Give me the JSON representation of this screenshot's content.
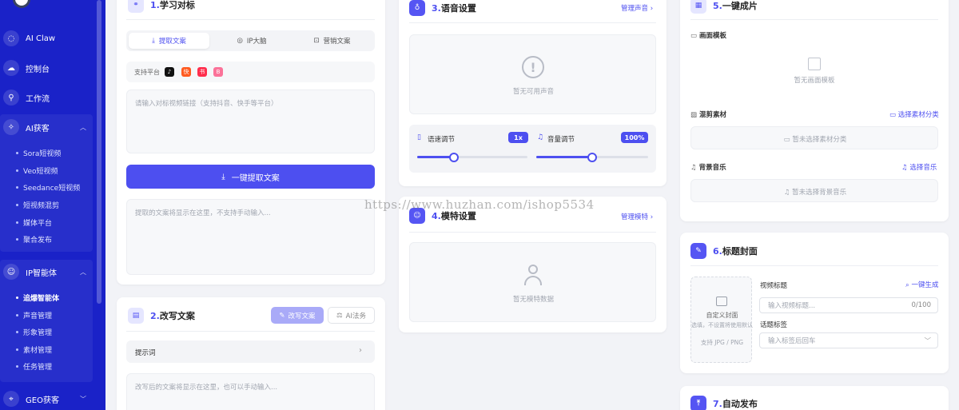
{
  "sidebar": {
    "items": [
      {
        "label": "AI Claw",
        "icon": "chat-icon"
      },
      {
        "label": "控制台",
        "icon": "cloud-icon"
      },
      {
        "label": "工作流",
        "icon": "flow-icon"
      },
      {
        "label": "AI获客",
        "icon": "sparkle-icon"
      }
    ],
    "ai_sub": [
      "Sora短视频",
      "Veo短视频",
      "Seedance短视频",
      "短视频混剪",
      "媒体平台",
      "聚合发布"
    ],
    "ip_group": {
      "label": "IP智能体",
      "icon": "user-icon"
    },
    "ip_sub": [
      "追爆智能体",
      "声音管理",
      "形象管理",
      "素材管理",
      "任务管理"
    ],
    "geo": {
      "label": "GEO获客",
      "icon": "location-icon"
    }
  },
  "learn": {
    "num": "1.",
    "title": "学习对标",
    "tabs": [
      "提取文案",
      "IP大脑",
      "营销文案"
    ],
    "platform_label": "支持平台",
    "platforms": [
      {
        "name": "douyin",
        "glyph": "♪",
        "color": "#111111"
      },
      {
        "name": "kuaishou",
        "glyph": "快",
        "color": "#ff5a1f"
      },
      {
        "name": "xiaohongshu",
        "glyph": "书",
        "color": "#ff2e4d"
      },
      {
        "name": "bilibili",
        "glyph": "B",
        "color": "#fb7299"
      }
    ],
    "link_placeholder": "请输入对标视频链接（支持抖音、快手等平台）",
    "extract_button": "一键提取文案",
    "result_placeholder": "提取的文案将显示在这里，不支持手动输入..."
  },
  "rewrite": {
    "num": "2.",
    "title": "改写文案",
    "rewrite_button": "改写文案",
    "ai_button": "AI法务",
    "prompt_label": "提示词",
    "result_placeholder": "改写后的文案将显示在这里，也可以手动输入..."
  },
  "voice": {
    "num": "3.",
    "title": "语音设置",
    "manage_link": "管理声音",
    "empty_text": "暂无可用声音",
    "speed_label": "语速调节",
    "speed_value": "1x",
    "speed_fraction": 0.33,
    "volume_label": "音量调节",
    "volume_value": "100%",
    "volume_fraction": 0.5
  },
  "model": {
    "num": "4.",
    "title": "模特设置",
    "manage_link": "管理模特",
    "empty_text": "暂无模特数据"
  },
  "compose": {
    "num": "5.",
    "title": "一键成片",
    "template_label": "画面模板",
    "template_empty": "暂无画面模板",
    "material_label": "混剪素材",
    "material_link": "选择素材分类",
    "material_empty": "暂未选择素材分类",
    "music_label": "背景音乐",
    "music_link": "选择音乐",
    "music_empty": "暂未选择背景音乐"
  },
  "cover": {
    "num": "6.",
    "title": "标题封面",
    "upload_title": "自定义封面",
    "upload_hint": "选填，不设置将使用默认",
    "upload_formats": "支持 JPG / PNG",
    "video_title_label": "视频标题",
    "generate_link": "一键生成",
    "video_title_placeholder": "输入视频标题...",
    "title_count": "0/100",
    "topic_label": "话题标签",
    "topic_placeholder": "输入标签后回车"
  },
  "publish": {
    "num": "7.",
    "title": "自动发布"
  },
  "watermark": "https://www.huzhan.com/ishop5534",
  "colors": {
    "accent": "#4d4ff0",
    "sidebar": "#1a22c8"
  }
}
